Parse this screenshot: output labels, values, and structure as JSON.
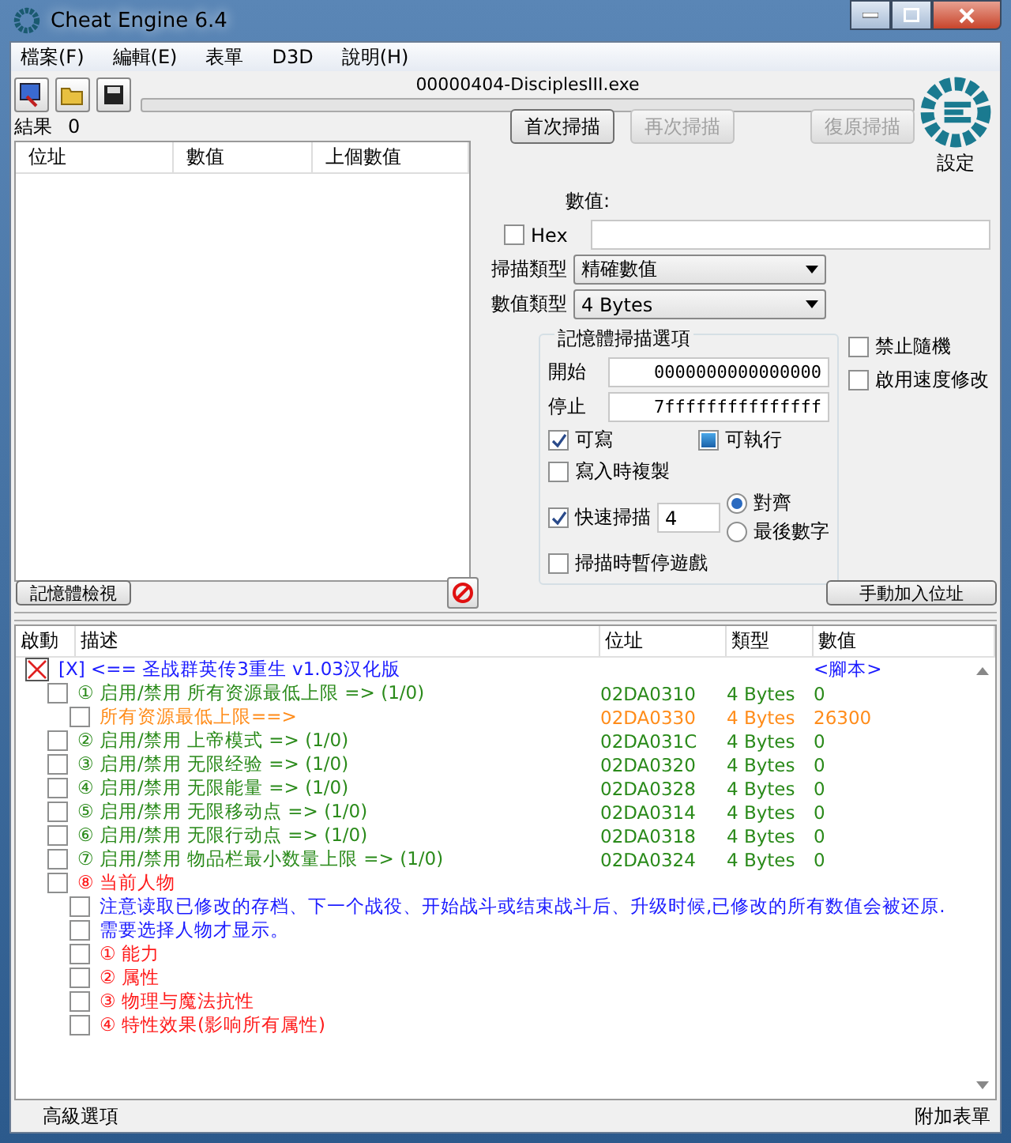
{
  "window": {
    "title": "Cheat Engine 6.4"
  },
  "menu": [
    "檔案(F)",
    "編輯(E)",
    "表單",
    "D3D",
    "說明(H)"
  ],
  "process": "00000404-DisciplesIII.exe",
  "results": {
    "label": "結果",
    "count": "0"
  },
  "found_list": {
    "columns": [
      "位址",
      "數值",
      "上個數值"
    ]
  },
  "scan_buttons": [
    {
      "label": "首次掃描",
      "disabled": false
    },
    {
      "label": "再次掃描",
      "disabled": true
    },
    {
      "label": "復原掃描",
      "disabled": true
    }
  ],
  "settings_label": "設定",
  "value_label": "數值:",
  "hex": {
    "label": "Hex",
    "checked": false
  },
  "scan_type": {
    "label": "掃描類型",
    "value": "精確數值"
  },
  "value_type": {
    "label": "數值類型",
    "value": "4 Bytes"
  },
  "memory_options": {
    "title": "記憶體掃描選項",
    "start_label": "開始",
    "start": "0000000000000000",
    "stop_label": "停止",
    "stop": "7fffffffffffffff",
    "writable": {
      "label": "可寫",
      "checked": true
    },
    "executable": {
      "label": "可執行",
      "checked": false,
      "indeterminate": true
    },
    "copy_on_write": {
      "label": "寫入時複製",
      "checked": false
    },
    "fast_scan": {
      "label": "快速掃描",
      "checked": true,
      "value": "4"
    },
    "alignment": [
      {
        "label": "對齊",
        "selected": true
      },
      {
        "label": "最後數字",
        "selected": false
      }
    ],
    "pause": {
      "label": "掃描時暫停遊戲",
      "checked": false
    }
  },
  "side_options": [
    {
      "label": "禁止隨機",
      "checked": false
    },
    {
      "label": "啟用速度修改",
      "checked": false
    }
  ],
  "memory_view_button": "記憶體檢視",
  "add_address_button": "手動加入位址",
  "cheat_table": {
    "columns": [
      "啟動",
      "描述",
      "位址",
      "類型",
      "數值"
    ],
    "rows": [
      {
        "kind": "script",
        "description": "[X] <== 圣战群英传3重生 v1.03汉化版",
        "value": "<腳本>",
        "color": "#1a1aff",
        "children": [
          {
            "kind": "entry",
            "description": "① 启用/禁用 所有资源最低上限 => (1/0)",
            "address": "02DA0310",
            "type": "4 Bytes",
            "value": "0",
            "color": "#2a8a1a",
            "children": [
              {
                "kind": "entry",
                "description": "所有资源最低上限==>",
                "address": "02DA0330",
                "type": "4 Bytes",
                "value": "26300",
                "color": "#ff8c1a"
              }
            ]
          },
          {
            "kind": "entry",
            "description": "② 启用/禁用 上帝模式 => (1/0)",
            "address": "02DA031C",
            "type": "4 Bytes",
            "value": "0",
            "color": "#2a8a1a"
          },
          {
            "kind": "entry",
            "description": "③ 启用/禁用 无限经验 => (1/0)",
            "address": "02DA0320",
            "type": "4 Bytes",
            "value": "0",
            "color": "#2a8a1a"
          },
          {
            "kind": "entry",
            "description": "④ 启用/禁用 无限能量 => (1/0)",
            "address": "02DA0328",
            "type": "4 Bytes",
            "value": "0",
            "color": "#2a8a1a"
          },
          {
            "kind": "entry",
            "description": "⑤ 启用/禁用 无限移动点 => (1/0)",
            "address": "02DA0314",
            "type": "4 Bytes",
            "value": "0",
            "color": "#2a8a1a"
          },
          {
            "kind": "entry",
            "description": "⑥ 启用/禁用 无限行动点 => (1/0)",
            "address": "02DA0318",
            "type": "4 Bytes",
            "value": "0",
            "color": "#2a8a1a"
          },
          {
            "kind": "entry",
            "description": "⑦ 启用/禁用 物品栏最小数量上限 => (1/0)",
            "address": "02DA0324",
            "type": "4 Bytes",
            "value": "0",
            "color": "#2a8a1a"
          },
          {
            "kind": "entry",
            "description": "⑧ 当前人物",
            "color": "#ff1a1a",
            "children": [
              {
                "kind": "entry",
                "description": "注意读取已修改的存档、下一个战役、开始战斗或结束战斗后、升级时候,已修改的所有数值会被还原.",
                "color": "#1a1aff"
              },
              {
                "kind": "entry",
                "description": "需要选择人物才显示。",
                "color": "#1a1aff"
              },
              {
                "kind": "entry",
                "description": "① 能力",
                "color": "#ff1a1a"
              },
              {
                "kind": "entry",
                "description": "② 属性",
                "color": "#ff1a1a"
              },
              {
                "kind": "entry",
                "description": "③ 物理与魔法抗性",
                "color": "#ff1a1a"
              },
              {
                "kind": "entry",
                "description": "④ 特性效果(影响所有属性)",
                "color": "#ff1a1a"
              }
            ]
          }
        ]
      }
    ]
  },
  "status_bar": {
    "left": "高級選項",
    "right": "附加表單"
  }
}
